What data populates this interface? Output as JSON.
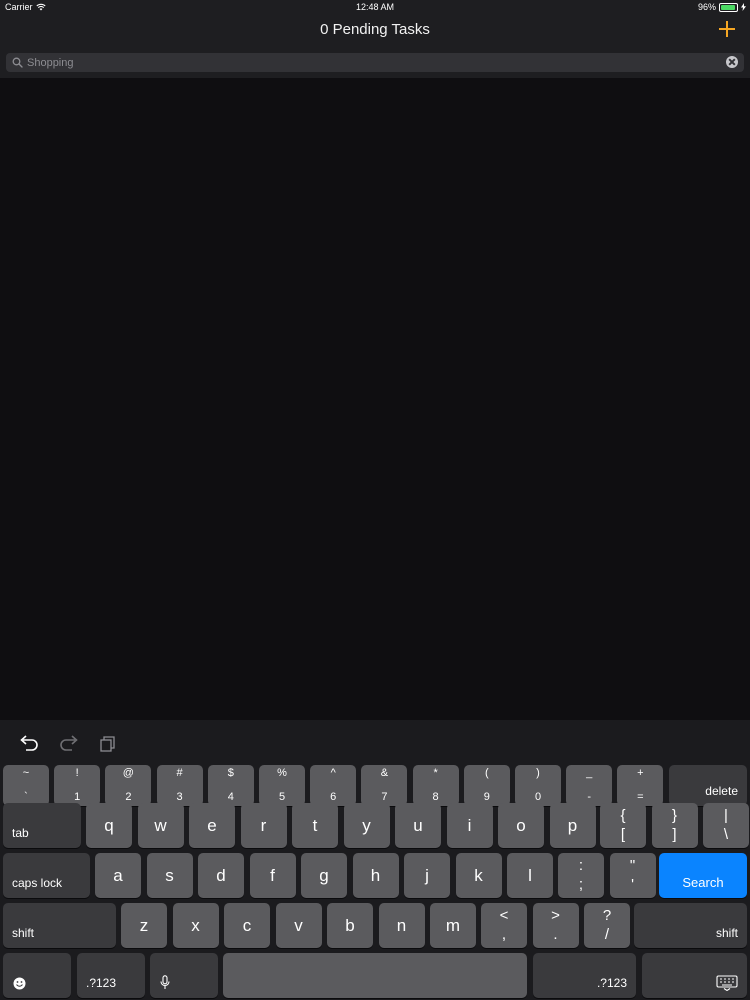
{
  "status_bar": {
    "carrier": "Carrier",
    "time": "12:48 AM",
    "battery_percent": "96%",
    "battery_level": 0.96,
    "wifi_icon": "wifi-icon",
    "charging_icon": "bolt-icon"
  },
  "nav": {
    "title": "0 Pending Tasks",
    "add_icon": "plus-icon",
    "accent_color": "#f5a623"
  },
  "search": {
    "value": "",
    "placeholder": "Shopping",
    "icon": "magnifier-icon",
    "clear_icon": "clear-icon"
  },
  "keyboard": {
    "shortcuts": [
      "undo-icon",
      "redo-icon",
      "paste-icon"
    ],
    "row1": [
      {
        "top": "~",
        "bottom": "`"
      },
      {
        "top": "!",
        "bottom": "1"
      },
      {
        "top": "@",
        "bottom": "2"
      },
      {
        "top": "#",
        "bottom": "3"
      },
      {
        "top": "$",
        "bottom": "4"
      },
      {
        "top": "%",
        "bottom": "5"
      },
      {
        "top": "^",
        "bottom": "6"
      },
      {
        "top": "&",
        "bottom": "7"
      },
      {
        "top": "*",
        "bottom": "8"
      },
      {
        "top": "(",
        "bottom": "9"
      },
      {
        "top": ")",
        "bottom": "0"
      },
      {
        "top": "_",
        "bottom": "-"
      },
      {
        "top": "+",
        "bottom": "="
      }
    ],
    "delete_label": "delete",
    "tab_label": "tab",
    "row2": [
      "q",
      "w",
      "e",
      "r",
      "t",
      "y",
      "u",
      "i",
      "o",
      "p"
    ],
    "row2_symbols": [
      {
        "top": "{",
        "bottom": "["
      },
      {
        "top": "}",
        "bottom": "]"
      },
      {
        "top": "|",
        "bottom": "\\"
      }
    ],
    "caps_label": "caps lock",
    "row3": [
      "a",
      "s",
      "d",
      "f",
      "g",
      "h",
      "j",
      "k",
      "l"
    ],
    "row3_symbols": [
      {
        "top": ":",
        "bottom": ";"
      },
      {
        "top": "\"",
        "bottom": "'"
      }
    ],
    "search_label": "Search",
    "search_color": "#0a84ff",
    "shift_label": "shift",
    "row4": [
      "z",
      "x",
      "c",
      "v",
      "b",
      "n",
      "m"
    ],
    "row4_symbols": [
      {
        "top": "<",
        "bottom": ","
      },
      {
        "top": ">",
        "bottom": "."
      },
      {
        "top": "?",
        "bottom": "/"
      }
    ],
    "numbers_label": ".?123",
    "emoji_icon": "emoji-icon",
    "mic_icon": "microphone-icon",
    "dismiss_icon": "keyboard-dismiss-icon"
  }
}
